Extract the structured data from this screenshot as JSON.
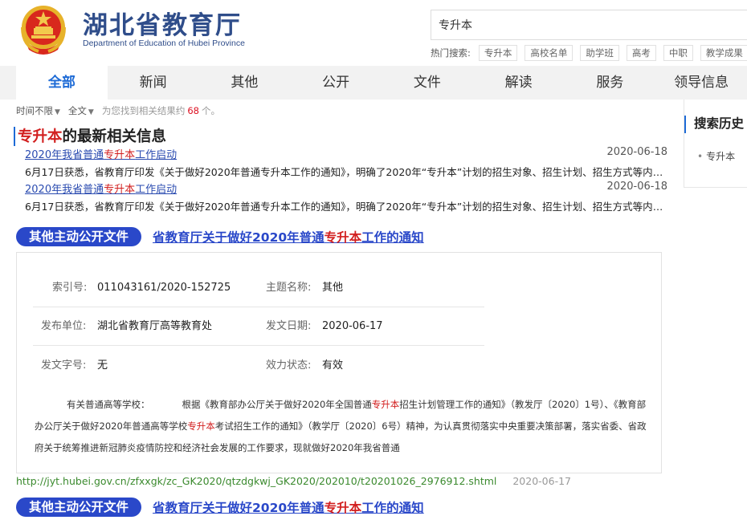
{
  "header": {
    "brand_cn": "湖北省教育厅",
    "brand_en": "Department of Education of Hubei Province",
    "search_value": "专升本",
    "hot_label": "热门搜索:",
    "hot_tags": [
      "专升本",
      "高校名单",
      "助学班",
      "高考",
      "中职",
      "教学成果"
    ]
  },
  "nav": {
    "items": [
      "全部",
      "新闻",
      "其他",
      "公开",
      "文件",
      "解读",
      "服务",
      "领导信息"
    ],
    "active": 0
  },
  "filters": {
    "time": "时间不限",
    "scope": "全文",
    "found_pre": "为您找到相关结果约",
    "count": "68",
    "found_post": "个。"
  },
  "latest": {
    "keyword": "专升本",
    "title_rest": "的最新相关信息",
    "items": [
      {
        "link_pre": "2020年我省普通",
        "link_kw": "专升本",
        "link_post": "工作启动",
        "date": "2020-06-18",
        "summary": "6月17日获悉，省教育厅印发《关于做好2020年普通专升本工作的通知》，明确了2020年“专升本”计划的招生对象、招生计划、招生方式等内容。"
      },
      {
        "link_pre": "2020年我省普通",
        "link_kw": "专升本",
        "link_post": "工作启动",
        "date": "2020-06-18",
        "summary": "6月17日获悉，省教育厅印发《关于做好2020年普通专升本工作的通知》，明确了2020年“专升本”计划的招生对象、招生计划、招生方式等内容。"
      }
    ]
  },
  "results": [
    {
      "badge": "其他主动公开文件",
      "title_pre": "省教育厅关于做好2020年普通",
      "title_kw": "专升本",
      "title_post": "工作的通知",
      "meta": {
        "index_label": "索引号:",
        "index_value": "011043161/2020-152725",
        "topic_label": "主题名称:",
        "topic_value": "其他",
        "issuer_label": "发布单位:",
        "issuer_value": "湖北省教育厅高等教育处",
        "date_label": "发文日期:",
        "date_value": "2020-06-17",
        "docno_label": "发文字号:",
        "docno_value": "无",
        "status_label": "效力状态:",
        "status_value": "有效"
      },
      "body": {
        "p1": "有关普通高等学校：",
        "p2a": "根据《教育部办公厅关于做好2020年全国普通",
        "kw1": "专升本",
        "p2b": "招生计划管理工作的通知》（教发厅〔2020〕1号）、《教育部办公厅关于做好2020年普通高等学校",
        "kw2": "专升本",
        "p2c": "考试招生工作的通知》（教学厅〔2020〕6号）精神，为认真贯彻落实中央重要决策部署，落实省委、省政府关于统筹推进新冠肺炎疫情防控和经济社会发展的工作要求，现就做好2020年我省普通"
      },
      "url": "http://jyt.hubei.gov.cn/zfxxgk/zc_GK2020/qtzdgkwj_GK2020/202010/t20201026_2976912.shtml",
      "url_date": "2020-06-17"
    },
    {
      "badge": "其他主动公开文件",
      "title_pre": "省教育厅关于做好2020年普通",
      "title_kw": "专升本",
      "title_post": "工作的通知"
    }
  ],
  "sidebar": {
    "title": "搜索历史",
    "items": [
      "专升本"
    ]
  },
  "colors": {
    "brand_blue": "#2f4d8a",
    "accent_blue": "#1e6bd6",
    "badge_blue": "#2a48c9",
    "keyword_red": "#d21f1f",
    "url_green": "#3b8a2e"
  }
}
